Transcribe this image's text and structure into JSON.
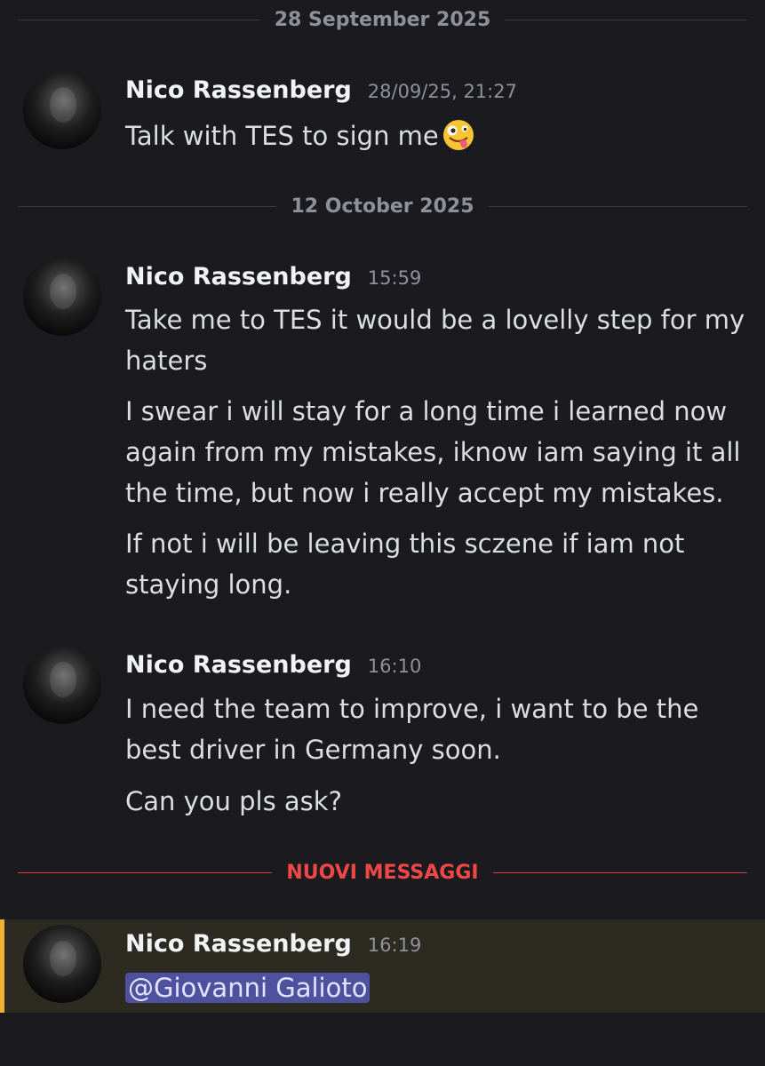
{
  "dividers": {
    "d1": "28 September 2025",
    "d2": "12 October 2025",
    "new_messages": "NUOVI MESSAGGI"
  },
  "messages": [
    {
      "author": "Nico Rassenberg",
      "timestamp": "28/09/25, 21:27",
      "lines": [
        "Talk with TES to sign me"
      ],
      "emoji": "zany-face-emoji"
    },
    {
      "author": "Nico Rassenberg",
      "timestamp": "15:59",
      "lines": [
        "Take me to TES it would be a lovelly step for my haters",
        "I swear i will stay for a long time i learned now again from my mistakes, iknow iam saying it all the time, but now i really accept my mistakes.",
        "If not i will be leaving this sczene if iam not staying long."
      ]
    },
    {
      "author": "Nico Rassenberg",
      "timestamp": "16:10",
      "lines": [
        "I need the team to improve, i want to be the best driver in Germany soon.",
        "Can you pls ask?"
      ]
    },
    {
      "author": "Nico Rassenberg",
      "timestamp": "16:19",
      "mention": "@Giovanni Galioto"
    }
  ],
  "colors": {
    "background": "#1b1b1f",
    "new_messages_accent": "#f04747",
    "mention_highlight": "#f0b232",
    "mention_pill": "#4e519e"
  }
}
